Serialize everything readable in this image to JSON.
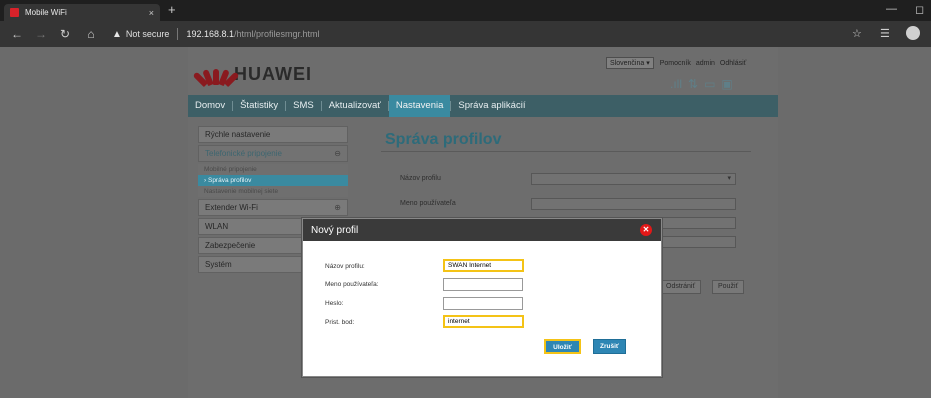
{
  "browser": {
    "tab_title": "Mobile WiFi",
    "tab_close": "×",
    "new_tab": "+",
    "security": "Not secure",
    "url_host": "192.168.8.1",
    "url_path": "/html/profilesmgr.html",
    "icons": [
      "back-icon",
      "forward-icon",
      "reload-icon",
      "home-icon",
      "star-icon",
      "collections-icon",
      "profile-icon"
    ]
  },
  "page": {
    "lang": "Slovenčina",
    "top_links": [
      "Pomocník",
      "admin",
      "Odhlásiť"
    ],
    "brand": "HUAWEI",
    "brand_color": "#8a1a1f",
    "nav": [
      "Domov",
      "Štatistiky",
      "SMS",
      "Aktualizovať",
      "Nastavenia",
      "Správa aplikácií"
    ],
    "nav_active": "Nastavenia",
    "sidebar": {
      "quick": "Rýchle nastavenie",
      "dial": "Telefonické pripojenie",
      "dial_subs": [
        "Mobilné pripojenie",
        "Správa profilov",
        "Nastavenie mobilnej siete"
      ],
      "dial_active": "Správa profilov",
      "others": [
        "Extender Wi-Fi",
        "WLAN",
        "Zabezpečenie",
        "Systém"
      ]
    },
    "title": "Správa profilov",
    "form": {
      "profile_name_label": "Názov profilu",
      "username_label": "Meno používateľa"
    },
    "buttons": {
      "delete": "Odstrániť",
      "apply": "Použiť"
    }
  },
  "modal": {
    "title": "Nový profil",
    "fields": [
      {
        "label": "Názov profilu:",
        "value": "SWAN Internet",
        "highlight": true
      },
      {
        "label": "Meno používateľa:",
        "value": "",
        "highlight": false
      },
      {
        "label": "Heslo:",
        "value": "",
        "highlight": false
      },
      {
        "label": "Prist. bod:",
        "value": "internet",
        "highlight": true
      }
    ],
    "save": "Uložiť",
    "cancel": "Zrušiť",
    "highlight_color": "#f4c316",
    "accent_color": "#2e86b4"
  }
}
